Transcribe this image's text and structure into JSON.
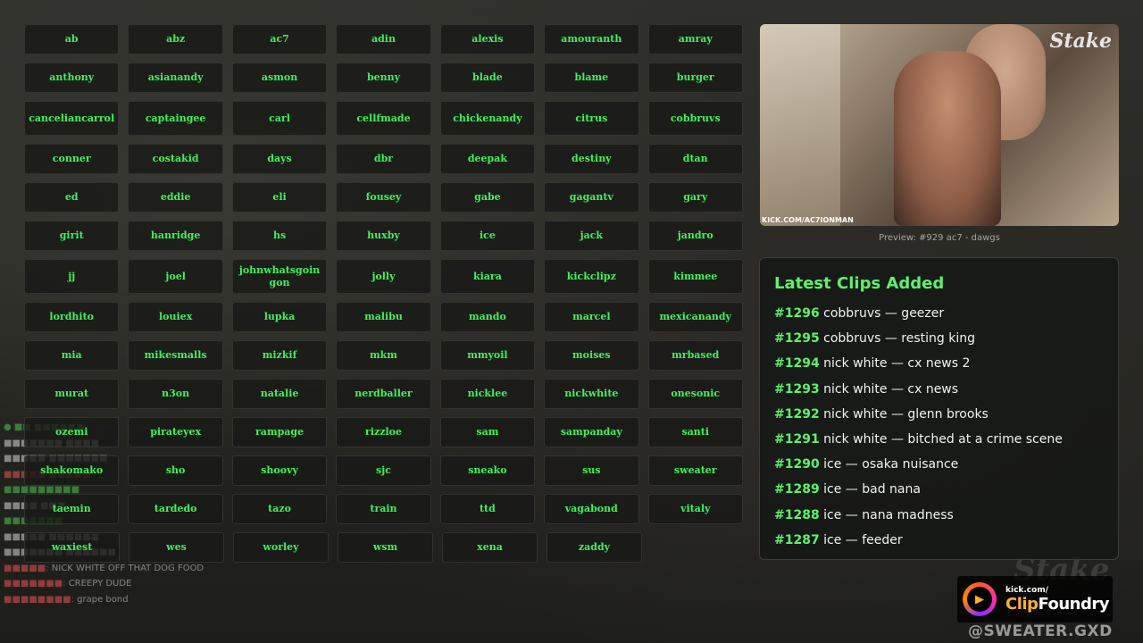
{
  "grid_rows": [
    [
      "ab",
      "abz",
      "ac7",
      "adin",
      "alexis",
      "amouranth",
      "amray"
    ],
    [
      "anthony",
      "asianandy",
      "asmon",
      "benny",
      "blade",
      "blame",
      "burger"
    ],
    [
      "canceliancarrol",
      "captaingee",
      "carl",
      "cellfmade",
      "chickenandy",
      "citrus",
      "cobbruvs"
    ],
    [
      "conner",
      "costakid",
      "days",
      "dbr",
      "deepak",
      "destiny",
      "dtan"
    ],
    [
      "ed",
      "eddie",
      "eli",
      "fousey",
      "gabe",
      "gagantv",
      "gary"
    ],
    [
      "girit",
      "hanridge",
      "hs",
      "huxby",
      "ice",
      "jack",
      "jandro"
    ],
    [
      "jj",
      "joel",
      "johnwhatsgoingon",
      "jolly",
      "kiara",
      "kickclipz",
      "kimmee"
    ],
    [
      "lordhito",
      "louiex",
      "lupka",
      "malibu",
      "mando",
      "marcel",
      "mexicanandy"
    ],
    [
      "mia",
      "mikesmalls",
      "mizkif",
      "mkm",
      "mmyoil",
      "moises",
      "mrbased"
    ],
    [
      "murat",
      "n3on",
      "natalie",
      "nerdballer",
      "nicklee",
      "nickwhite",
      "onesonic"
    ],
    [
      "ozemi",
      "pirateyex",
      "rampage",
      "rizzloe",
      "sam",
      "sampanday",
      "santi"
    ],
    [
      "shakomako",
      "sho",
      "shoovy",
      "sjc",
      "sneako",
      "sus",
      "sweater"
    ],
    [
      "taemin",
      "tardedo",
      "tazo",
      "train",
      "ttd",
      "vagabond",
      "vitaly"
    ],
    [
      "waxiest",
      "wes",
      "worley",
      "wsm",
      "xena",
      "zaddy"
    ]
  ],
  "preview": {
    "caption": "Preview: #929 ac7 - dawgs",
    "watermark": "Stake",
    "channel_label": "KICK.COM/AC7IONMAN"
  },
  "clips": {
    "title": "Latest Clips Added",
    "items": [
      {
        "num": "#1296",
        "text": "cobbruvs — geezer"
      },
      {
        "num": "#1295",
        "text": "cobbruvs — resting king"
      },
      {
        "num": "#1294",
        "text": "nick white — cx news 2"
      },
      {
        "num": "#1293",
        "text": "nick white — cx news"
      },
      {
        "num": "#1292",
        "text": "nick white — glenn brooks"
      },
      {
        "num": "#1291",
        "text": "nick white — bitched at a crime scene"
      },
      {
        "num": "#1290",
        "text": "ice — osaka nuisance"
      },
      {
        "num": "#1289",
        "text": "ice — bad nana"
      },
      {
        "num": "#1288",
        "text": "ice — nana madness"
      },
      {
        "num": "#1287",
        "text": "ice — feeder"
      }
    ]
  },
  "brand": {
    "small": "kick.com/",
    "big_a": "Clip",
    "big_b": "Foundry"
  },
  "handle": "@SWEATER.GXD",
  "bg_chat": [
    "NICK WHITE OFF THAT DOG FOOD",
    "CREEPY DUDE",
    "grape bond"
  ],
  "colors": {
    "accent": "#3df25a",
    "heading": "#5cf26c"
  }
}
